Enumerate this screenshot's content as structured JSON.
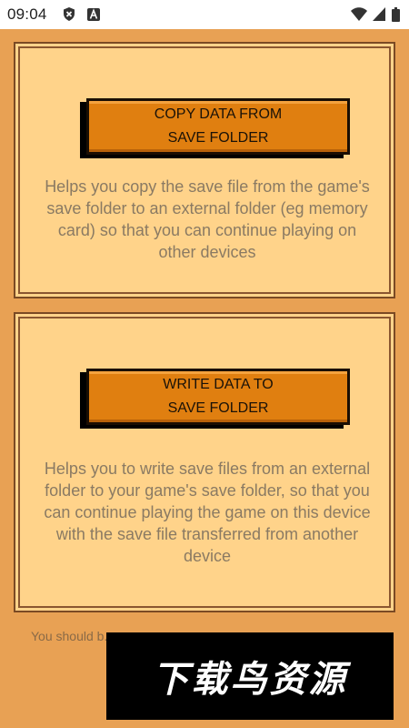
{
  "status_bar": {
    "time": "09:04",
    "left_icons": [
      "shield-x-icon",
      "a-letter-icon"
    ],
    "right_icons": [
      "wifi-icon",
      "cell-signal-icon",
      "battery-icon"
    ]
  },
  "copy_panel": {
    "button_label_line1": "COPY DATA FROM",
    "button_label_line2": "SAVE FOLDER",
    "description": "Helps you copy the save file from the game's save folder to an external folder (eg memory card) so that you can continue playing on other devices"
  },
  "write_panel": {
    "button_label_line1": "WRITE DATA TO",
    "button_label_line2": "SAVE FOLDER",
    "description": "Helps you to write save files from an external folder to your game's save folder, so that you can continue playing the game on this device with the save file transferred from another device"
  },
  "footer": {
    "note": "You should b..."
  },
  "watermark": {
    "text": "下载鸟资源"
  },
  "colors": {
    "background": "#e8a154",
    "panel": "#ffd38a",
    "button": "#e07f10",
    "text": "#8a7a63"
  }
}
